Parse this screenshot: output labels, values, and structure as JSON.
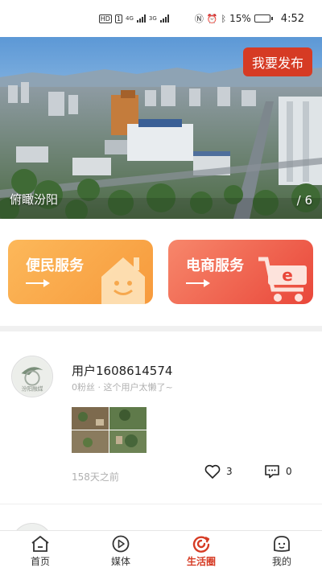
{
  "status_bar": {
    "hd_label": "HD",
    "net_1": "4G",
    "net_2": "3G",
    "battery_percent": "15%",
    "time": "4:52",
    "battery_level": 0.15,
    "battery_color": "#e23b2c"
  },
  "banner": {
    "caption": "俯瞰汾阳",
    "counter": "/ 6",
    "publish_label": "我要发布"
  },
  "services": [
    {
      "label": "便民服务",
      "icon": "smiley-house-icon"
    },
    {
      "label": "电商服务",
      "icon": "shopping-cart-icon"
    }
  ],
  "post": {
    "avatar_text": "汾阳融媒",
    "username": "用户1608614574",
    "subinfo": "0粉丝 · 这个用户太懒了~",
    "time_ago": "158天之前",
    "likes": "3",
    "comments": "0"
  },
  "tabs": [
    {
      "label": "首页",
      "icon": "home-icon",
      "active": false
    },
    {
      "label": "媒体",
      "icon": "play-icon",
      "active": false
    },
    {
      "label": "生活圈",
      "icon": "life-circle-icon",
      "active": true
    },
    {
      "label": "我的",
      "icon": "profile-icon",
      "active": false
    }
  ],
  "colors": {
    "accent": "#d63b24",
    "service_orange": "#f79a3c",
    "service_red": "#e9473a"
  }
}
